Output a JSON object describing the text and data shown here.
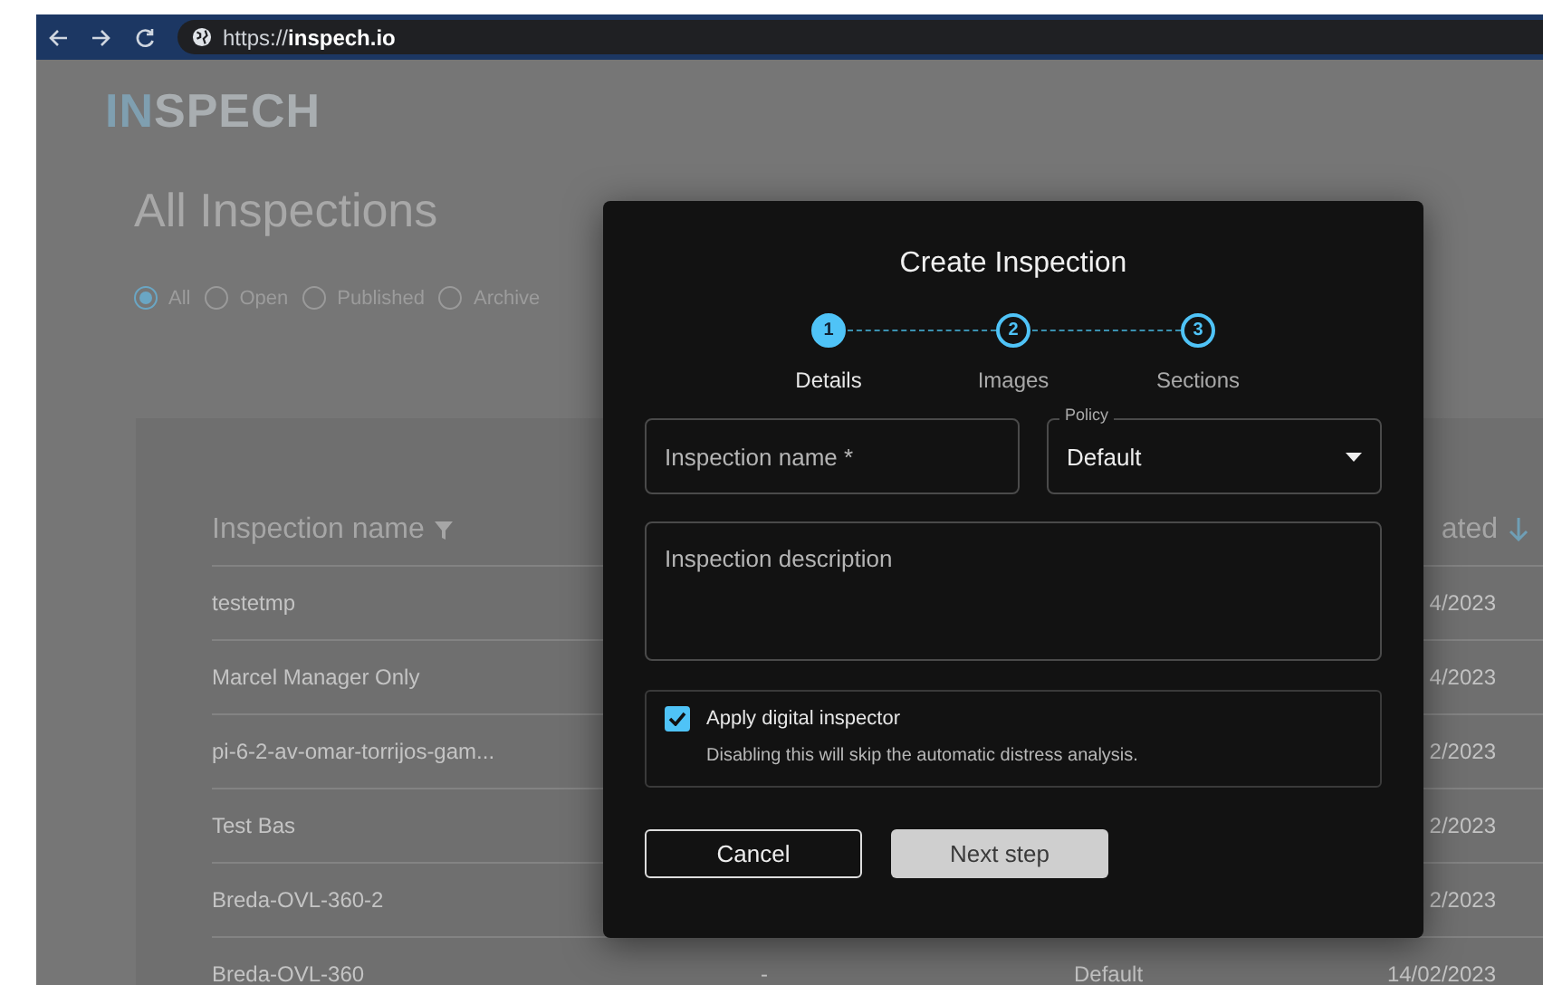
{
  "browser": {
    "url_prefix": "https://",
    "url_host": "inspech.io"
  },
  "logo": {
    "accent": "IN",
    "rest": "SPECH"
  },
  "page_title": "All Inspections",
  "filters": [
    {
      "label": "All",
      "selected": true
    },
    {
      "label": "Open",
      "selected": false
    },
    {
      "label": "Published",
      "selected": false
    },
    {
      "label": "Archive",
      "selected": false
    }
  ],
  "table": {
    "columns": [
      {
        "label": "Inspection name",
        "kind": "filter"
      },
      {
        "label": "ated",
        "kind": "sort"
      }
    ],
    "rows": [
      {
        "name": "testetmp",
        "date": "4/2023"
      },
      {
        "name": "Marcel Manager Only",
        "date": "4/2023"
      },
      {
        "name": "pi-6-2-av-omar-torrijos-gam...",
        "date": "2/2023"
      },
      {
        "name": "Test Bas",
        "date": "2/2023"
      },
      {
        "name": "Breda-OVL-360-2",
        "date": "2/2023"
      },
      {
        "name": "Breda-OVL-360",
        "column_2": "-",
        "column_3": "Default",
        "date": "14/02/2023"
      }
    ]
  },
  "dialog": {
    "title": "Create Inspection",
    "steps": [
      {
        "number": "1",
        "label": "Details",
        "active": true
      },
      {
        "number": "2",
        "label": "Images",
        "active": false
      },
      {
        "number": "3",
        "label": "Sections",
        "active": false
      }
    ],
    "name_field": {
      "placeholder": "Inspection name *"
    },
    "policy_field": {
      "label": "Policy",
      "value": "Default"
    },
    "description_field": {
      "placeholder": "Inspection description"
    },
    "digital_inspector": {
      "label": "Apply digital inspector",
      "hint": "Disabling this will skip the automatic distress analysis.",
      "checked": true
    },
    "cancel_button": "Cancel",
    "next_button": {
      "label": "Next step",
      "disabled": true
    }
  }
}
